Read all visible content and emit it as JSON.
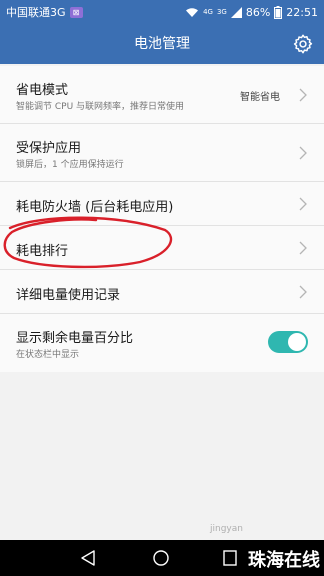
{
  "status_bar": {
    "carrier": "中国联通3G",
    "sim_badge": "⊠",
    "network_small": "4G",
    "network_type": "3G",
    "battery_percent": "86%",
    "time": "22:51"
  },
  "app_bar": {
    "title": "电池管理",
    "settings_icon": "gear-icon"
  },
  "settings": {
    "items": [
      {
        "title": "省电模式",
        "subtitle": "智能调节 CPU 与联网频率，推荐日常使用",
        "value": "智能省电"
      },
      {
        "title": "受保护应用",
        "subtitle": "锁屏后，1 个应用保持运行"
      },
      {
        "title": "耗电防火墙 (后台耗电应用)"
      },
      {
        "title": "耗电排行"
      },
      {
        "title": "详细电量使用记录"
      },
      {
        "title": "显示剩余电量百分比",
        "subtitle": "在状态栏中显示",
        "toggle_on": true
      }
    ]
  },
  "watermark": {
    "main": "珠海在线",
    "sub": "jingyan"
  },
  "colors": {
    "primary": "#3b6fb3",
    "toggle_accent": "#2fb7b0",
    "annotation": "#d9202a"
  }
}
